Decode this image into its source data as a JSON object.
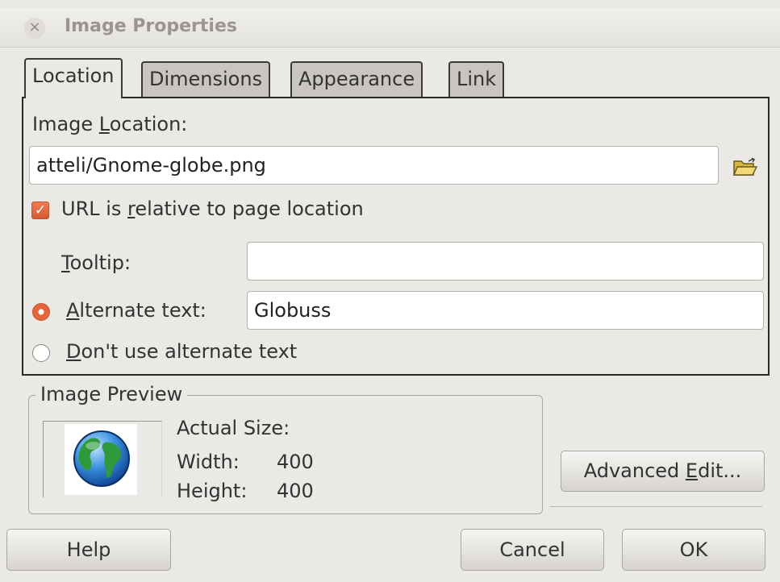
{
  "window": {
    "title": "Image Properties",
    "close_glyph": "×"
  },
  "tabs": [
    {
      "label": "Location",
      "active": true
    },
    {
      "label": "Dimensions",
      "active": false
    },
    {
      "label": "Appearance",
      "active": false
    },
    {
      "label": "Link",
      "active": false
    }
  ],
  "location": {
    "image_location_label": {
      "pre": "Image ",
      "accel": "L",
      "post": "ocation:"
    },
    "image_location_value": "atteli/Gnome-globe.png",
    "browse_icon": "folder-open-icon",
    "relative_checkbox": {
      "checked": true,
      "pre": "URL is ",
      "accel": "r",
      "post": "elative to page location"
    },
    "tooltip_label": {
      "accel": "T",
      "post": "ooltip:"
    },
    "tooltip_value": "",
    "alt_radio": {
      "selected": true,
      "accel": "A",
      "post": "lternate text:"
    },
    "alt_value": "Globuss",
    "no_alt_radio": {
      "selected": false,
      "accel": "D",
      "post": "on't use alternate text"
    }
  },
  "preview": {
    "frame_title": "Image Preview",
    "thumbnail_icon": "globe-icon",
    "actual_size_label": "Actual Size:",
    "width_label": "Width:",
    "width_value": "400",
    "height_label": "Height:",
    "height_value": "400"
  },
  "buttons": {
    "advanced_edit": {
      "pre": "Advanced ",
      "accel": "E",
      "post": "dit..."
    },
    "help": "Help",
    "cancel": "Cancel",
    "ok": "OK"
  },
  "colors": {
    "accent": "#e8643a",
    "background": "#ebe9e5"
  }
}
